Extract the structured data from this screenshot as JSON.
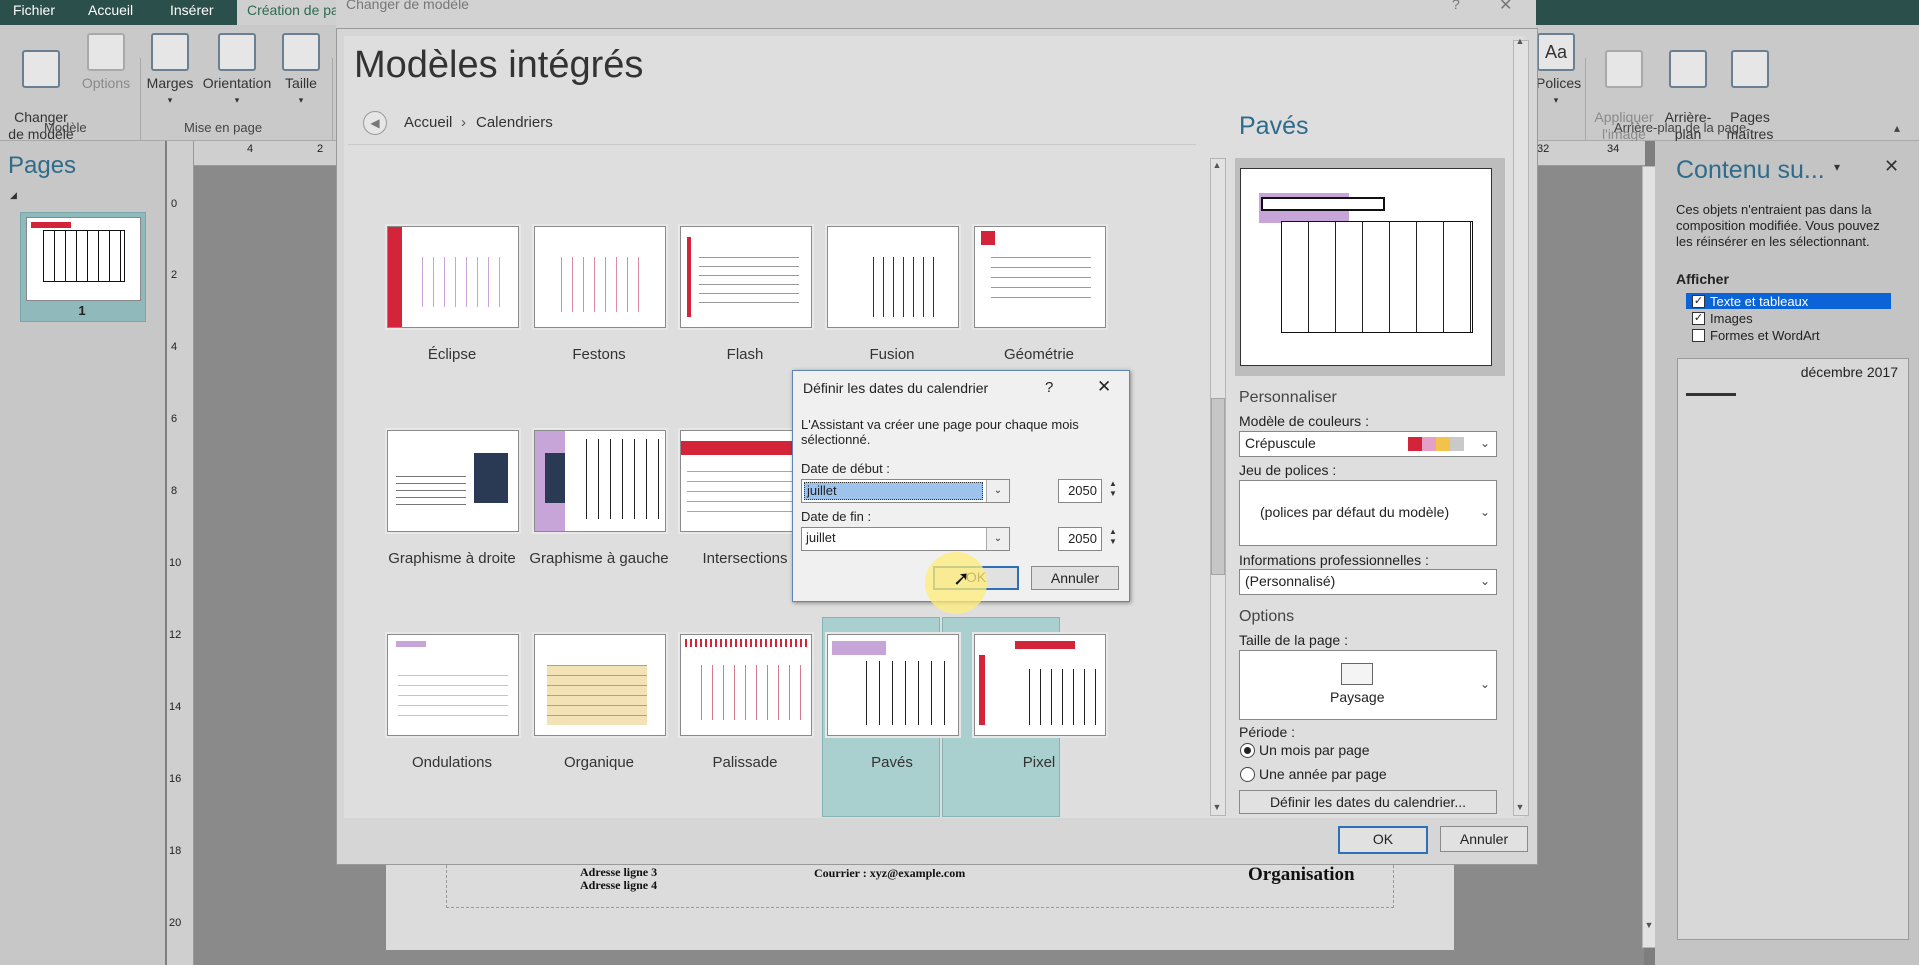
{
  "ribbon": {
    "tabs": [
      "Fichier",
      "Accueil",
      "Insérer",
      "Création de pa"
    ],
    "active_tab_index": 3,
    "buttons": {
      "changer_modele": "Changer\nde modèle",
      "options": "Options",
      "marges": "Marges",
      "orientation": "Orientation",
      "taille": "Taille",
      "polices": "Polices",
      "appliquer_image": "Appliquer\nl'image",
      "arriere_plan": "Arrière-\nplan",
      "pages_maitres": "Pages\nmaîtres"
    },
    "groups": {
      "modele": "Modèle",
      "mise_en_page": "Mise en page",
      "arriere_plan": "Arrière-plan de la page"
    }
  },
  "pages_pane": {
    "title": "Pages",
    "page_number": "1"
  },
  "rulers": {
    "h_ticks": [
      "4",
      "2",
      "32",
      "34"
    ],
    "v_ticks": [
      "0",
      "2",
      "4",
      "6",
      "8",
      "10",
      "12",
      "14",
      "16",
      "18",
      "20"
    ]
  },
  "document": {
    "line1": "Adresse ligne 3",
    "line2": "Adresse ligne 4",
    "courrier": "Courrier : xyz@example.com",
    "organisation": "Organisation"
  },
  "content_pane": {
    "title": "Contenu su...",
    "desc": "Ces objets n'entraient pas dans la composition modifiée. Vous pouvez les réinsérer en les sélectionnant.",
    "afficher": "Afficher",
    "options": [
      {
        "label": "Texte et tableaux",
        "checked": true
      },
      {
        "label": "Images",
        "checked": true
      },
      {
        "label": "Formes et WordArt",
        "checked": false
      }
    ],
    "list_date": "décembre 2017"
  },
  "dialog": {
    "title": "Changer de modèle",
    "heading": "Modèles intégrés",
    "breadcrumb": [
      "Accueil",
      "Calendriers"
    ],
    "templates": [
      {
        "name": "Éclipse"
      },
      {
        "name": "Festons"
      },
      {
        "name": "Flash"
      },
      {
        "name": "Fusion"
      },
      {
        "name": "Géométrie"
      },
      {
        "name": "Graphisme à droite"
      },
      {
        "name": "Graphisme à gauche"
      },
      {
        "name": "Intersections"
      },
      {
        "name": "Ondulations"
      },
      {
        "name": "Organique"
      },
      {
        "name": "Palissade"
      },
      {
        "name": "Pavés",
        "selected": true
      },
      {
        "name": "Pixel",
        "selected": true
      }
    ],
    "side": {
      "title": "Pavés",
      "personnaliser": "Personnaliser",
      "color_label": "Modèle de couleurs :",
      "color_value": "Crépuscule",
      "swatches": [
        "#d4243a",
        "#e5a0c8",
        "#f3c24a",
        "#c9c9c9"
      ],
      "font_label": "Jeu de polices :",
      "font_value": "(polices par défaut du modèle)",
      "info_label": "Informations professionnelles :",
      "info_value": "(Personnalisé)",
      "options": "Options",
      "page_size_label": "Taille de la page :",
      "page_size_value": "Paysage",
      "periode_label": "Période :",
      "periode_options": [
        "Un mois par page",
        "Une année par page"
      ],
      "periode_selected": 0,
      "define_dates_button": "Définir les dates du calendrier..."
    },
    "ok": "OK",
    "cancel": "Annuler"
  },
  "date_dialog": {
    "title": "Définir les dates du calendrier",
    "help": "?",
    "description": "L'Assistant va créer une page pour chaque mois sélectionné.",
    "start_label": "Date de début :",
    "start_month": "juillet",
    "start_year": "2050",
    "end_label": "Date de fin :",
    "end_month": "juillet",
    "end_year": "2050",
    "ok": "OK",
    "cancel": "Annuler"
  },
  "accent_color": "#2f6b8a",
  "selection_color": "#0a64d8"
}
